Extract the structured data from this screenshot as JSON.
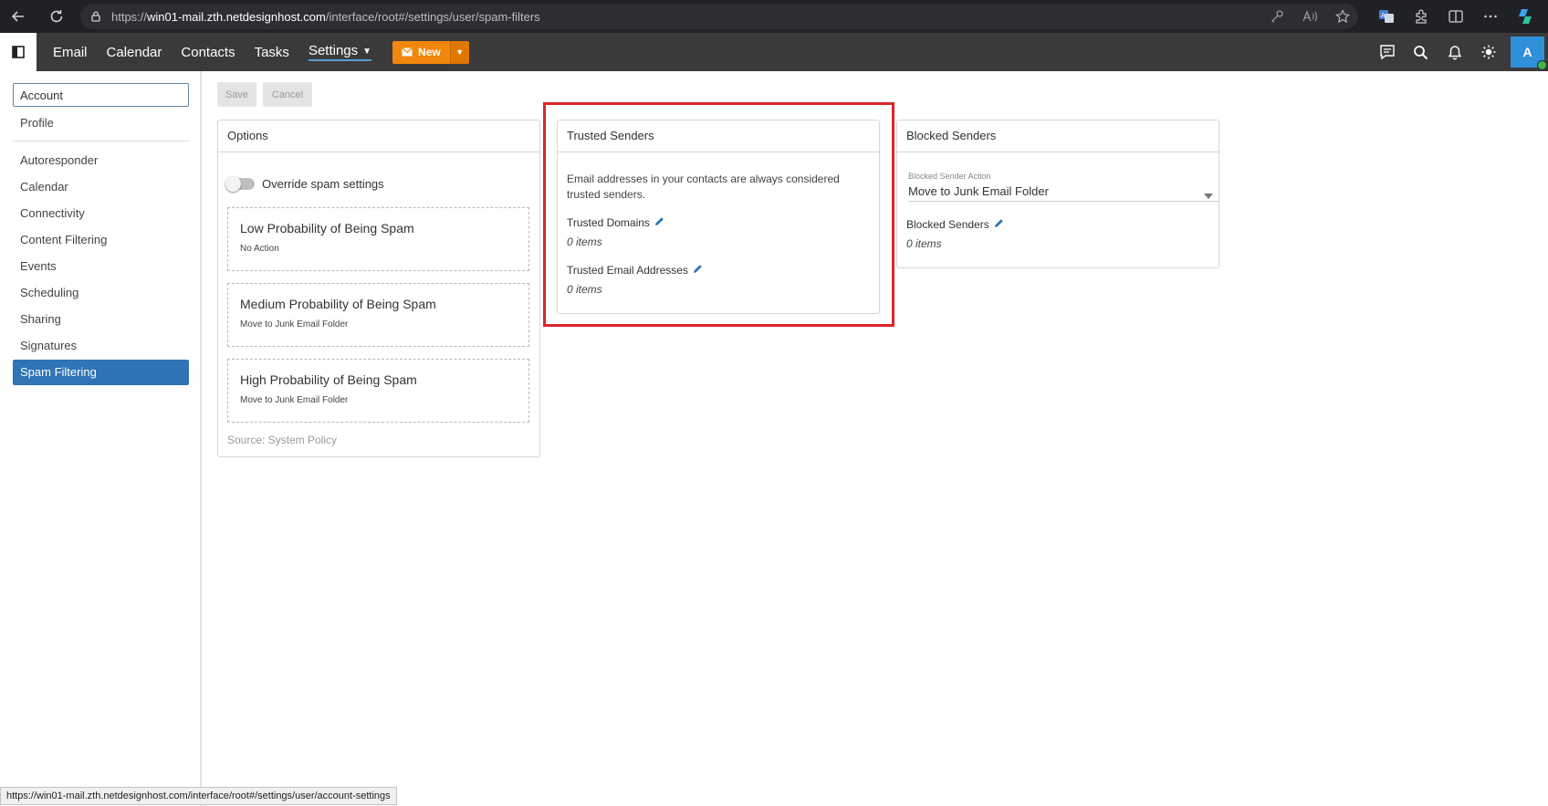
{
  "browser": {
    "url_scheme": "https://",
    "url_host": "win01-mail.zth.netdesignhost.com",
    "url_path": "/interface/root#/settings/user/spam-filters"
  },
  "topnav": {
    "items": [
      "Email",
      "Calendar",
      "Contacts",
      "Tasks",
      "Settings"
    ],
    "active": "Settings",
    "new_label": "New",
    "avatar_letter": "A"
  },
  "sidebar": {
    "account": "Account",
    "profile": "Profile",
    "items": [
      "Autoresponder",
      "Calendar",
      "Connectivity",
      "Content Filtering",
      "Events",
      "Scheduling",
      "Sharing",
      "Signatures"
    ],
    "active": "Spam Filtering"
  },
  "actions": {
    "save": "Save",
    "cancel": "Cancel"
  },
  "options": {
    "title": "Options",
    "override_label": "Override spam settings",
    "probabilities": [
      {
        "title": "Low Probability of Being Spam",
        "action": "No Action"
      },
      {
        "title": "Medium Probability of Being Spam",
        "action": "Move to Junk Email Folder"
      },
      {
        "title": "High Probability of Being Spam",
        "action": "Move to Junk Email Folder"
      }
    ],
    "source": "Source: System Policy"
  },
  "trusted": {
    "title": "Trusted Senders",
    "description": "Email addresses in your contacts are always considered trusted senders.",
    "domains_label": "Trusted Domains",
    "domains_count": "0 items",
    "emails_label": "Trusted Email Addresses",
    "emails_count": "0 items"
  },
  "blocked": {
    "title": "Blocked Senders",
    "action_label": "Blocked Sender Action",
    "action_value": "Move to Junk Email Folder",
    "list_label": "Blocked Senders",
    "list_count": "0 items"
  },
  "status_url": "https://win01-mail.zth.netdesignhost.com/interface/root#/settings/user/account-settings",
  "colors": {
    "accent": "#2f74b5",
    "new_button": "#f2870d",
    "highlight": "#d9262b"
  }
}
